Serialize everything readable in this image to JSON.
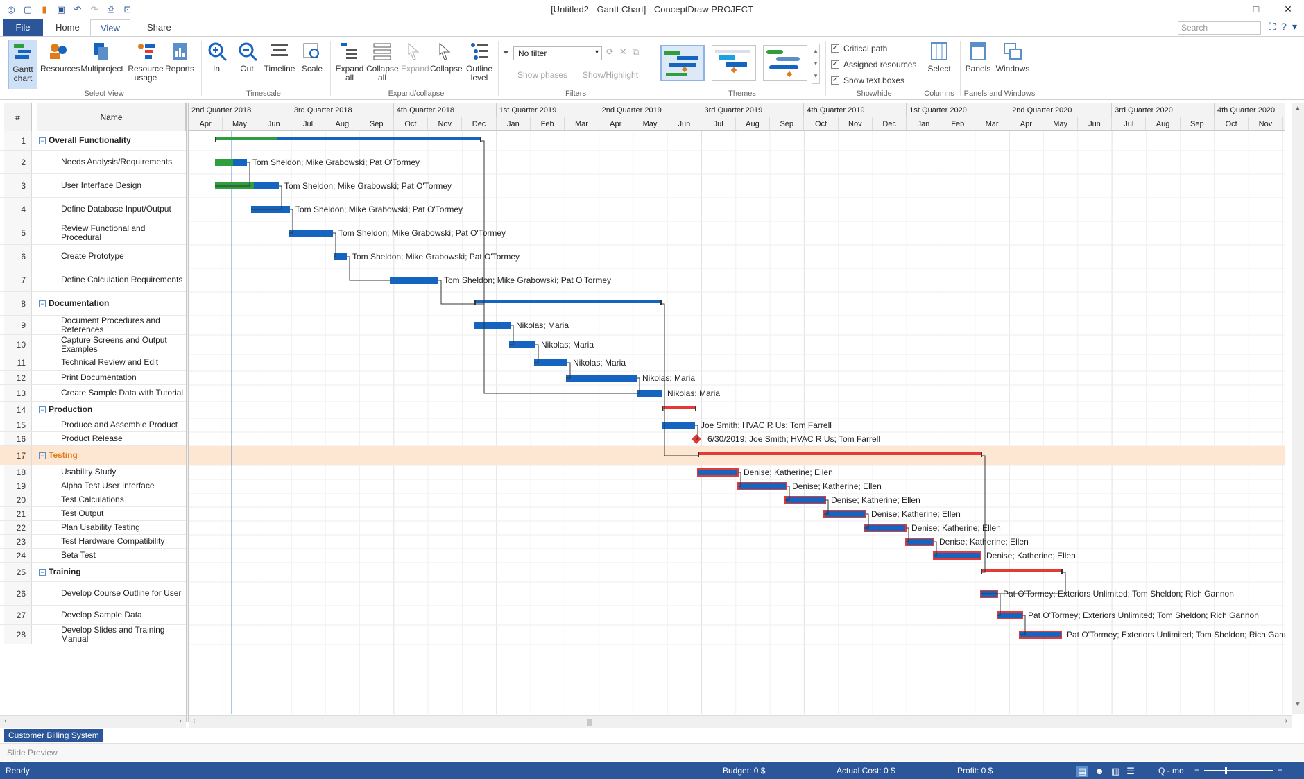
{
  "window": {
    "title": "[Untitled2 - Gantt Chart] - ConceptDraw PROJECT"
  },
  "tabs": {
    "file": "File",
    "home": "Home",
    "view": "View",
    "share": "Share"
  },
  "search": {
    "placeholder": "Search"
  },
  "ribbon": {
    "gantt": "Gantt chart",
    "resources": "Resources",
    "multiproject": "Multiproject",
    "resource_usage": "Resource usage",
    "reports": "Reports",
    "select_view": "Select View",
    "in": "In",
    "out": "Out",
    "timeline": "Timeline",
    "scale": "Scale",
    "timescale": "Timescale",
    "expand_all": "Expand all",
    "collapse_all": "Collapse all",
    "expand": "Expand",
    "collapse": "Collapse",
    "outline_level": "Outline level",
    "expand_collapse": "Expand/collapse",
    "filter_value": "No filter",
    "show_phases": "Show phases",
    "show_highlight": "Show/Highlight",
    "filters": "Filters",
    "themes": "Themes",
    "critical_path": "Critical path",
    "assigned_resources": "Assigned resources",
    "show_text_boxes": "Show text boxes",
    "show_hide": "Show/hide",
    "select": "Select",
    "columns": "Columns",
    "panels": "Panels",
    "windows": "Windows",
    "panels_windows": "Panels and Windows"
  },
  "grid": {
    "num_header": "#",
    "name_header": "Name"
  },
  "timescale": {
    "quarters": [
      "2nd Quarter 2018",
      "3rd Quarter 2018",
      "4th Quarter 2018",
      "1st Quarter 2019",
      "2nd Quarter 2019",
      "3rd Quarter 2019",
      "4th Quarter 2019",
      "1st Quarter 2020",
      "2nd Quarter 2020",
      "3rd Quarter 2020",
      "4th Quarter 2020"
    ],
    "months": [
      "Apr",
      "May",
      "Jun",
      "Jul",
      "Aug",
      "Sep",
      "Oct",
      "Nov",
      "Dec",
      "Jan",
      "Feb",
      "Mar",
      "Apr",
      "May",
      "Jun",
      "Jul",
      "Aug",
      "Sep",
      "Oct",
      "Nov",
      "Dec",
      "Jan",
      "Feb",
      "Mar",
      "Apr",
      "May",
      "Jun",
      "Jul",
      "Aug",
      "Sep",
      "Oct",
      "Nov"
    ]
  },
  "tasks": [
    {
      "id": "1",
      "name": "Overall Functionality",
      "summary": true
    },
    {
      "id": "2",
      "name": "Needs Analysis/Requirements",
      "res": "Tom Sheldon; Mike Grabowski; Pat O'Tormey"
    },
    {
      "id": "3",
      "name": "User Interface Design",
      "res": "Tom Sheldon; Mike Grabowski; Pat O'Tormey"
    },
    {
      "id": "4",
      "name": "Define Database Input/Output",
      "res": "Tom Sheldon; Mike Grabowski; Pat O'Tormey"
    },
    {
      "id": "5",
      "name": "Review Functional and Procedural",
      "res": "Tom Sheldon; Mike Grabowski; Pat O'Tormey"
    },
    {
      "id": "6",
      "name": "Create Prototype",
      "res": "Tom Sheldon; Mike Grabowski; Pat O'Tormey"
    },
    {
      "id": "7",
      "name": "Define Calculation Requirements",
      "res": "Tom Sheldon; Mike Grabowski; Pat O'Tormey"
    },
    {
      "id": "8",
      "name": "Documentation",
      "summary": true
    },
    {
      "id": "9",
      "name": "Document Procedures and References",
      "res": "Nikolas; Maria"
    },
    {
      "id": "10",
      "name": "Capture Screens and Output Examples",
      "res": "Nikolas; Maria"
    },
    {
      "id": "11",
      "name": "Technical Review and Edit",
      "res": "Nikolas; Maria"
    },
    {
      "id": "12",
      "name": "Print Documentation",
      "res": "Nikolas; Maria"
    },
    {
      "id": "13",
      "name": "Create Sample Data with Tutorial",
      "res": "Nikolas; Maria"
    },
    {
      "id": "14",
      "name": "Production",
      "summary": true
    },
    {
      "id": "15",
      "name": "Produce and Assemble Product",
      "res": "Joe Smith; HVAC R Us; Tom Farrell"
    },
    {
      "id": "16",
      "name": "Product Release",
      "res": "6/30/2019; Joe Smith; HVAC R Us; Tom Farrell"
    },
    {
      "id": "17",
      "name": "Testing",
      "summary": true
    },
    {
      "id": "18",
      "name": "Usability Study",
      "res": "Denise; Katherine; Ellen"
    },
    {
      "id": "19",
      "name": "Alpha Test User Interface",
      "res": "Denise; Katherine; Ellen"
    },
    {
      "id": "20",
      "name": "Test Calculations",
      "res": "Denise; Katherine; Ellen"
    },
    {
      "id": "21",
      "name": "Test Output",
      "res": "Denise; Katherine; Ellen"
    },
    {
      "id": "22",
      "name": "Plan Usability Testing",
      "res": "Denise; Katherine; Ellen"
    },
    {
      "id": "23",
      "name": "Test Hardware Compatibility",
      "res": "Denise; Katherine; Ellen"
    },
    {
      "id": "24",
      "name": "Beta Test",
      "res": "Denise; Katherine; Ellen"
    },
    {
      "id": "25",
      "name": "Training",
      "summary": true
    },
    {
      "id": "26",
      "name": "Develop Course Outline for User",
      "res": "Pat O'Tormey; Exteriors Unlimited; Tom Sheldon; Rich Gannon"
    },
    {
      "id": "27",
      "name": "Develop Sample Data",
      "res": "Pat O'Tormey; Exteriors Unlimited; Tom Sheldon; Rich Gannon"
    },
    {
      "id": "28",
      "name": "Develop Slides and Training Manual",
      "res": "Pat O'Tormey; Exteriors Unlimited; Tom Sheldon; Rich Gannon"
    }
  ],
  "sheet_tab": "Customer Billing System",
  "slide_preview": "Slide Preview",
  "status": {
    "ready": "Ready",
    "budget": "Budget: 0 $",
    "actual": "Actual Cost: 0 $",
    "profit": "Profit: 0 $",
    "zoom": "Q - mo"
  },
  "colors": {
    "accent": "#2b579a",
    "bar": "#1565c0",
    "progress": "#2e9e3e",
    "critical": "#e53935",
    "highlight": "#fde6d2"
  }
}
